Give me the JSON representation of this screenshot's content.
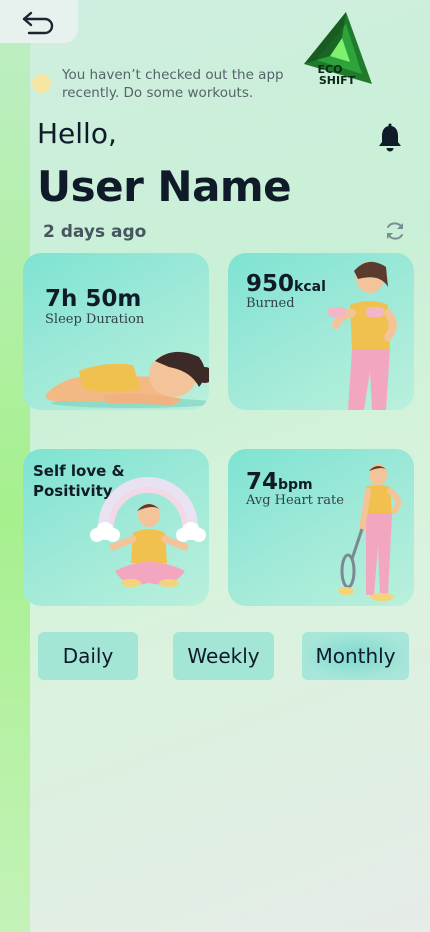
{
  "header": {
    "notice": "You haven’t checked out the app recently. Do some workouts.",
    "greeting": "Hello,",
    "user_name": "User Name",
    "last_seen": "2 days ago",
    "logo_text_line1": "ECO",
    "logo_text_line2": "SHIFT"
  },
  "icons": {
    "back": "back-arrow-icon",
    "bell": "bell-icon",
    "refresh": "refresh-icon",
    "notice": "notice-dot-icon"
  },
  "cards": {
    "sleep": {
      "value": "7h 50m",
      "label": "Sleep Duration"
    },
    "calories": {
      "value": "950",
      "unit": "kcal",
      "label": "Burned"
    },
    "selflove": {
      "line1": "Self love &",
      "line2": "Positivity"
    },
    "heart": {
      "value": "74",
      "unit": "bpm",
      "label": "Avg Heart rate"
    }
  },
  "tabs": [
    {
      "label": "Daily"
    },
    {
      "label": "Weekly"
    },
    {
      "label": "Monthly"
    }
  ],
  "colors": {
    "accent": "#7ee3d2",
    "text_dark": "#0f1b28",
    "logo_green": "#1f7a2c"
  }
}
